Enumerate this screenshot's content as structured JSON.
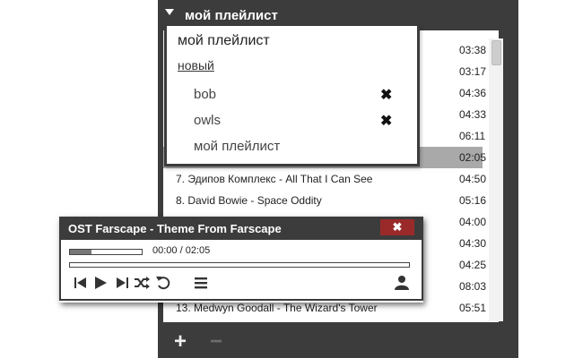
{
  "playlist_panel": {
    "header_title": "мой плейлист",
    "tracks": [
      {
        "title": "",
        "time": "03:38"
      },
      {
        "title": "",
        "time": "03:17"
      },
      {
        "title": "",
        "time": "04:36"
      },
      {
        "title": "",
        "time": "04:33"
      },
      {
        "title": "",
        "time": "06:11"
      },
      {
        "title": "",
        "time": "02:05",
        "active": true
      },
      {
        "title": "7. Эдипов Комплекс - All That I Can See",
        "time": "04:50"
      },
      {
        "title": "8. David Bowie - Space Oddity",
        "time": "05:16"
      },
      {
        "title": "",
        "time": "04:00"
      },
      {
        "title": "",
        "time": "04:30"
      },
      {
        "title": "",
        "time": "04:25"
      },
      {
        "title": "",
        "time": "08:03"
      },
      {
        "title": "13. Medwyn Goodall - The Wizard's Tower",
        "time": "05:51"
      }
    ],
    "footer": {
      "add_label": "+",
      "remove_label": "−"
    }
  },
  "playlist_dropdown": {
    "current": "мой плейлист",
    "new_label": "новый",
    "items": [
      {
        "name": "bob",
        "deletable": true
      },
      {
        "name": "owls",
        "deletable": true
      },
      {
        "name": "мой плейлист",
        "deletable": false
      }
    ],
    "delete_glyph": "✖"
  },
  "player": {
    "title": "OST Farscape - Theme From Farscape",
    "close_glyph": "✖",
    "time_display": "00:00 / 02:05",
    "volume_level": 0.3,
    "seek_progress": 0,
    "controls": [
      "previous-icon",
      "play-icon",
      "next-icon",
      "shuffle-icon",
      "repeat-icon",
      "playlist-menu-icon",
      "user-icon"
    ]
  },
  "colors": {
    "panel_bg": "#3c3c3c",
    "active_row": "#a9a9a9",
    "close_button": "#9a2a2a"
  }
}
